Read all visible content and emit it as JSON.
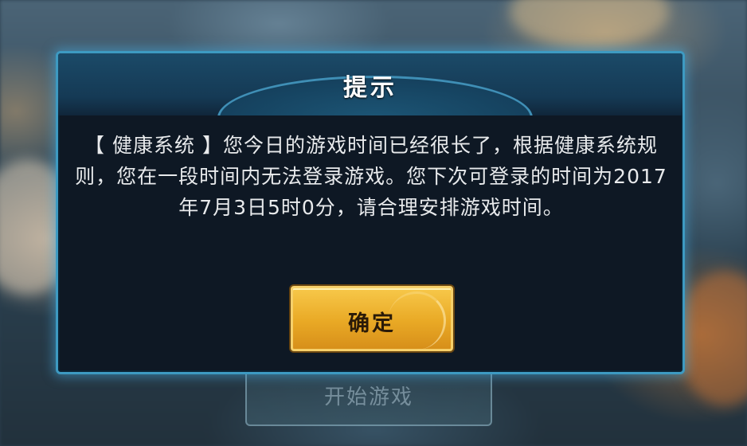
{
  "dialog": {
    "title": "提示",
    "message": "【 健康系统 】您今日的游戏时间已经很长了，根据健康系统规则，您在一段时间内无法登录游戏。您下次可登录的时间为2017年7月3日5时0分，请合理安排游戏时间。",
    "confirm_label": "确定"
  },
  "background": {
    "start_button_label": "开始游戏"
  },
  "colors": {
    "dialog_border": "#3d9ac2",
    "dialog_bg": "#0e1824",
    "confirm_button": "#e9a925",
    "title_text": "#ffffff"
  }
}
